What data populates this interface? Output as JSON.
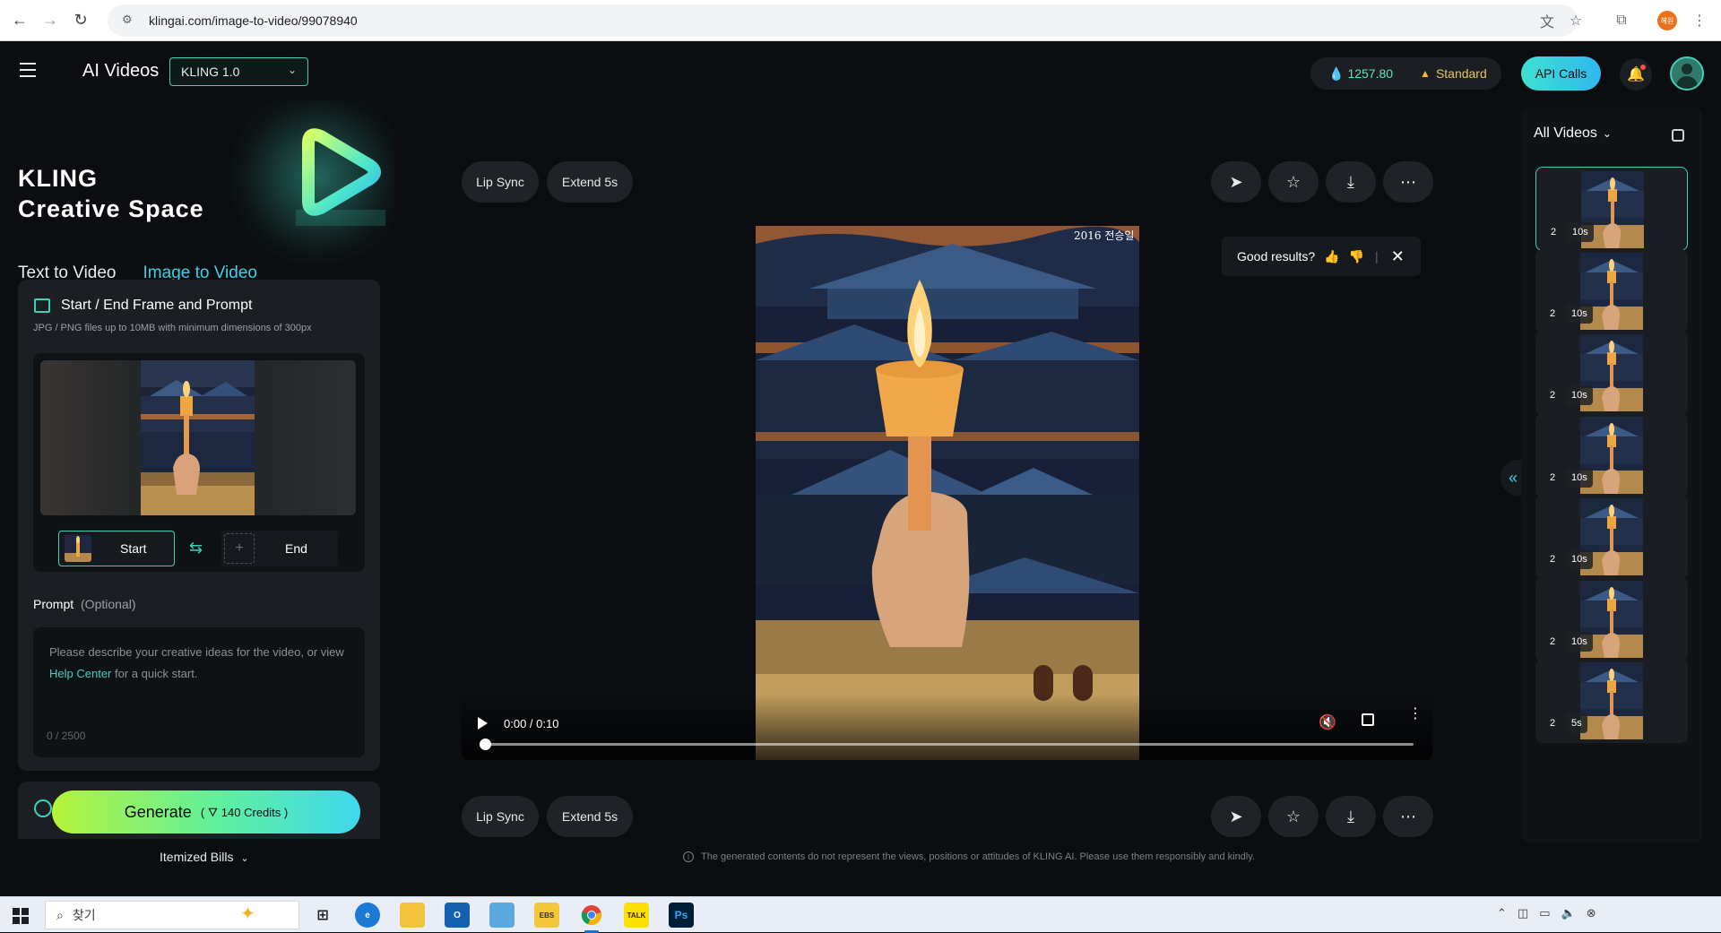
{
  "browser": {
    "url": "klingai.com/image-to-video/99078940",
    "profile_initials": "혜원"
  },
  "header": {
    "app_title": "AI Videos",
    "model": "KLING 1.0",
    "credits": "1257.80",
    "plan": "Standard",
    "api_button": "API Calls"
  },
  "brand": {
    "line1": "KLING",
    "line2": "Creative Space"
  },
  "mode_tabs": [
    "Text to Video",
    "Image to Video"
  ],
  "frame_card": {
    "title": "Start / End Frame and Prompt",
    "hint": "JPG / PNG files up to 10MB with minimum dimensions of 300px",
    "start_label": "Start",
    "end_label": "End"
  },
  "prompt": {
    "label": "Prompt",
    "optional": "(Optional)",
    "placeholder_before": "Please describe your creative ideas for the video, or view ",
    "placeholder_link": "Help Center",
    "placeholder_after": " for a quick start.",
    "count": "0 / 2500"
  },
  "generate": {
    "label": "Generate",
    "cost": "140 Credits )",
    "cost_prefix": "(",
    "itemized": "Itemized Bills"
  },
  "actions": {
    "lip_sync": "Lip Sync",
    "extend": "Extend 5s"
  },
  "player": {
    "time": "0:00 / 0:10",
    "progress": 0.0,
    "artwork_signature": "2016 전승일"
  },
  "feedback": {
    "question": "Good results?"
  },
  "disclaimer": "The generated contents do not represent the views, positions or attitudes of KLING AI. Please use them responsibly and kindly.",
  "history": {
    "title": "All Videos",
    "items": [
      {
        "count": "2",
        "duration": "10s"
      },
      {
        "count": "2",
        "duration": "10s"
      },
      {
        "count": "2",
        "duration": "10s"
      },
      {
        "count": "2",
        "duration": "10s"
      },
      {
        "count": "2",
        "duration": "10s"
      },
      {
        "count": "2",
        "duration": "10s"
      },
      {
        "count": "2",
        "duration": "5s"
      }
    ]
  },
  "taskbar": {
    "search_placeholder": "찾기",
    "apps": [
      "task-view",
      "edge",
      "file-explorer",
      "outlook",
      "media",
      "ebs",
      "chrome",
      "kakaotalk",
      "photoshop"
    ]
  },
  "colors": {
    "accent": "#3fd0b8",
    "credit": "#5ce6b3",
    "plan": "#e8c46a",
    "background": "#0b0d10"
  }
}
